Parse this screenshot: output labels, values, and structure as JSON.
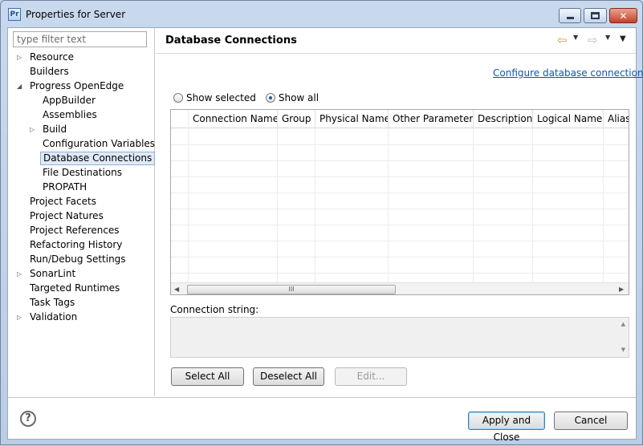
{
  "window": {
    "title": "Properties for Server"
  },
  "filter": {
    "placeholder": "type filter text"
  },
  "tree": [
    {
      "label": "Resource",
      "twisty": "▷"
    },
    {
      "label": "Builders",
      "twisty": ""
    },
    {
      "label": "Progress OpenEdge",
      "twisty": "◢"
    },
    {
      "label": "AppBuilder",
      "twisty": ""
    },
    {
      "label": "Assemblies",
      "twisty": ""
    },
    {
      "label": "Build",
      "twisty": "▷"
    },
    {
      "label": "Configuration Variables",
      "twisty": ""
    },
    {
      "label": "Database Connections",
      "twisty": ""
    },
    {
      "label": "File Destinations",
      "twisty": ""
    },
    {
      "label": "PROPATH",
      "twisty": ""
    },
    {
      "label": "Project Facets",
      "twisty": ""
    },
    {
      "label": "Project Natures",
      "twisty": ""
    },
    {
      "label": "Project References",
      "twisty": ""
    },
    {
      "label": "Refactoring History",
      "twisty": ""
    },
    {
      "label": "Run/Debug Settings",
      "twisty": ""
    },
    {
      "label": "SonarLint",
      "twisty": "▷"
    },
    {
      "label": "Targeted Runtimes",
      "twisty": ""
    },
    {
      "label": "Task Tags",
      "twisty": ""
    },
    {
      "label": "Validation",
      "twisty": "▷"
    }
  ],
  "page": {
    "title": "Database Connections",
    "config_link": "Configure database connections",
    "show_selected": "Show selected",
    "show_all": "Show all",
    "selected_radio": "show_all",
    "columns": [
      "Connection Name",
      "Group",
      "Physical Name",
      "Other Parameters",
      "Description",
      "Logical Name",
      "Alias"
    ],
    "connection_string_label": "Connection string:",
    "select_all": "Select All",
    "deselect_all": "Deselect All",
    "edit": "Edit...",
    "scroll_grip": "III"
  },
  "footer": {
    "help_glyph": "?",
    "apply_close": "Apply and Close",
    "cancel": "Cancel"
  },
  "icons": {
    "back_arrow": "⇦",
    "forward_arrow": "⇨",
    "dropdown": "▼",
    "scroll_left": "◀",
    "scroll_right": "▶",
    "scroll_up": "▲",
    "scroll_down": "▼",
    "close": "✕"
  }
}
